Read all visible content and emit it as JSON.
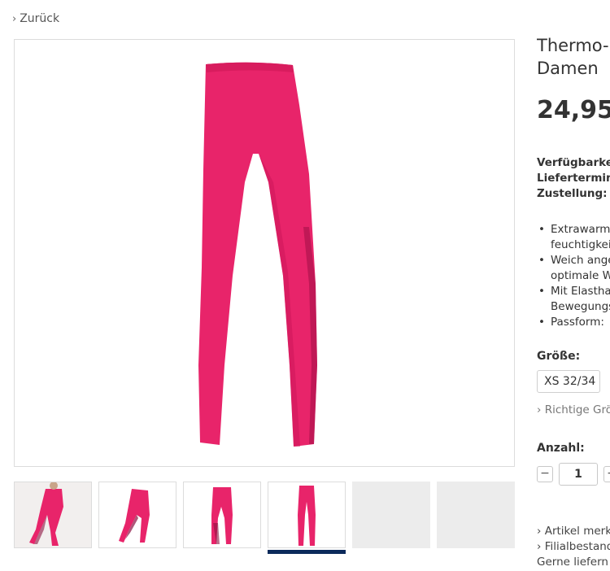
{
  "nav": {
    "back_label": "Zurück"
  },
  "product": {
    "title_line1": "Thermo-",
    "title_line2": "Damen",
    "price": "24,95",
    "info": [
      "Verfügbarke",
      "Liefertermin",
      "Zustellung:"
    ],
    "features": [
      {
        "bullet": "•",
        "lines": [
          "Extrawarm",
          "feuchtigkei"
        ]
      },
      {
        "bullet": "•",
        "lines": [
          "Weich ange",
          "optimale W"
        ]
      },
      {
        "bullet": "•",
        "lines": [
          "Mit Elastha",
          "Bewegungs"
        ]
      },
      {
        "bullet": "•",
        "lines": [
          "Passform:"
        ]
      }
    ],
    "size_label": "Größe:",
    "size_value": "XS 32/34",
    "size_guide": "Richtige Grö",
    "qty_label": "Anzahl:",
    "qty_value": "1",
    "qty_minus": "−",
    "qty_plus": "+",
    "links": [
      "Artikel merk",
      "Filialbestand",
      "Gerne liefern"
    ]
  },
  "colors": {
    "leggings": "#e8246a",
    "accent": "#0b2a5b"
  }
}
